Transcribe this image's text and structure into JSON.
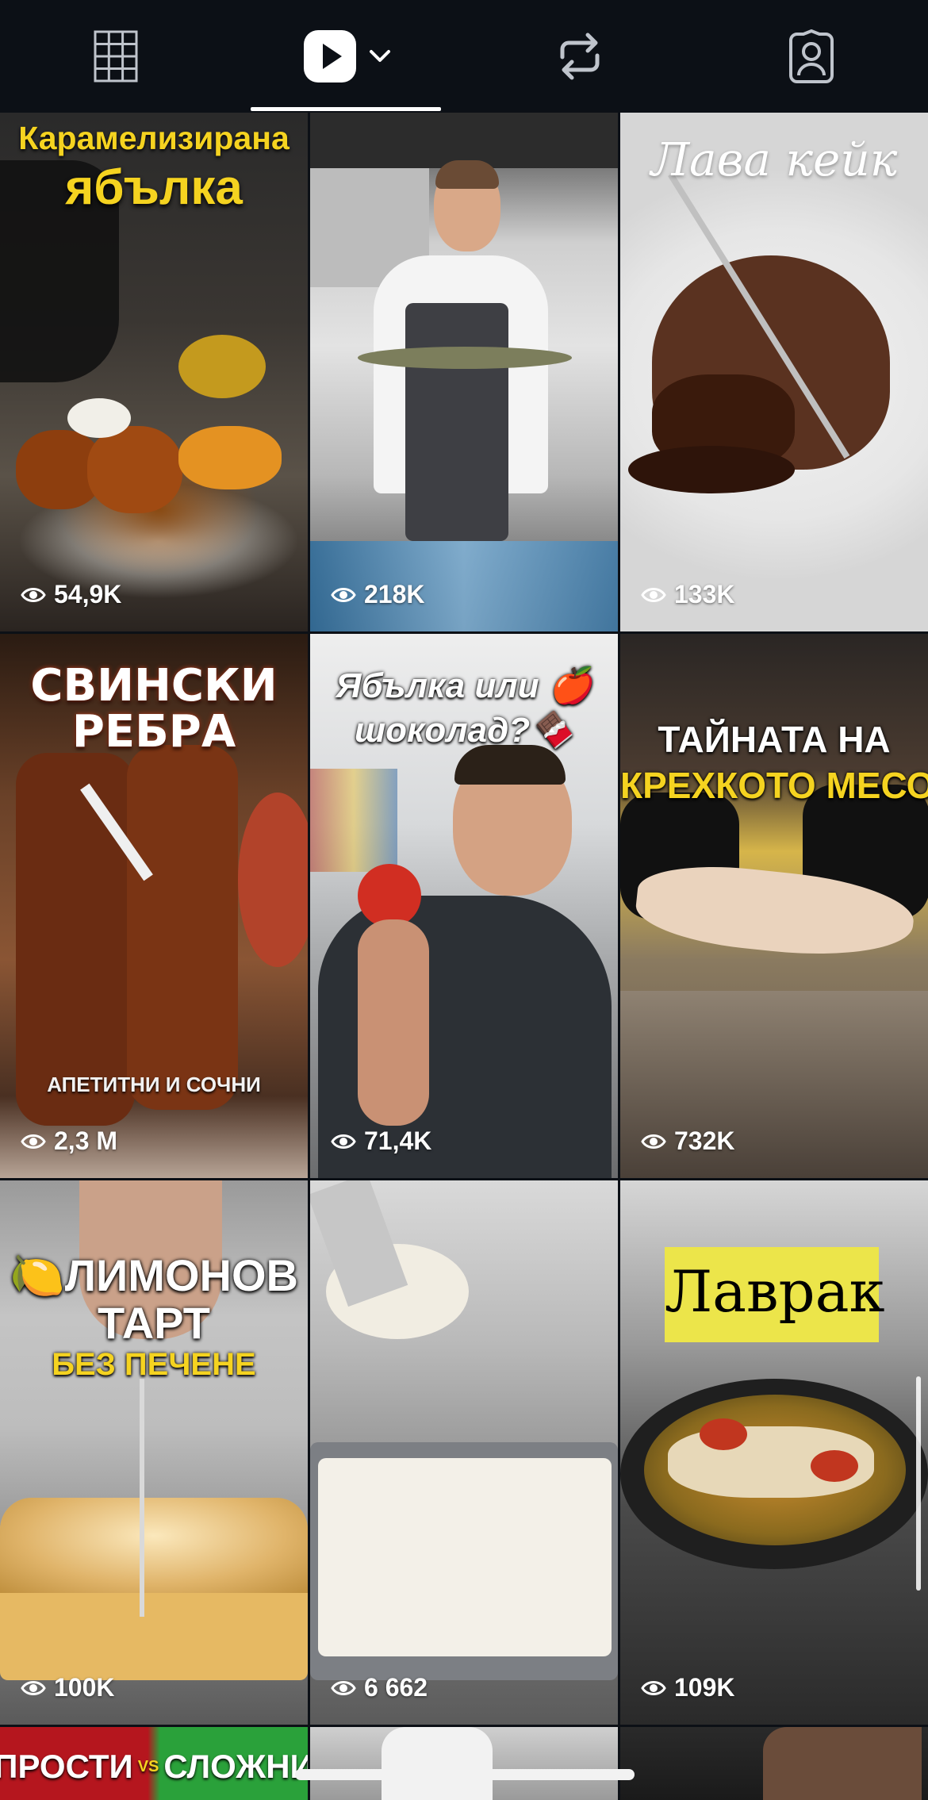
{
  "tabs": [
    {
      "name": "grid",
      "icon": "grid-icon"
    },
    {
      "name": "reels",
      "icon": "reels-play-icon",
      "selected": true
    },
    {
      "name": "reposts",
      "icon": "repost-icon"
    },
    {
      "name": "tagged",
      "icon": "tagged-person-icon"
    }
  ],
  "tiles": [
    {
      "title_line1": "Карамелизирана",
      "title_line2": "ябълка",
      "views": "54,9K"
    },
    {
      "views": "218K"
    },
    {
      "title_line1": "Лава кейк",
      "views": "133K"
    },
    {
      "title_line1": "СВИНСКИ",
      "title_line2": "РЕБРА",
      "subtitle": "АПЕТИТНИ И СОЧНИ",
      "views": "2,3 М"
    },
    {
      "title_line1": "Ябълка или 🍎",
      "title_line2": "шоколад?🍫",
      "views": "71,4K"
    },
    {
      "title_line1": "ТАЙНАТА НА",
      "title_line2": "КРЕХКОТО МЕСО",
      "views": "732K"
    },
    {
      "title_line1": "🍋ЛИМОНОВ",
      "title_line2": "ТАРТ",
      "subtitle": "БЕЗ ПЕЧЕНЕ",
      "views": "100K"
    },
    {
      "views": "6 662"
    },
    {
      "title_line1": "Лаврак",
      "views": "109K"
    },
    {
      "title_line1": "ПРОСТИ",
      "title_vs": "VS",
      "title_line2": "СЛОЖНИ"
    }
  ],
  "colors": {
    "background": "#0c1016",
    "yellow_title": "#f5d320",
    "white": "#ffffff"
  }
}
